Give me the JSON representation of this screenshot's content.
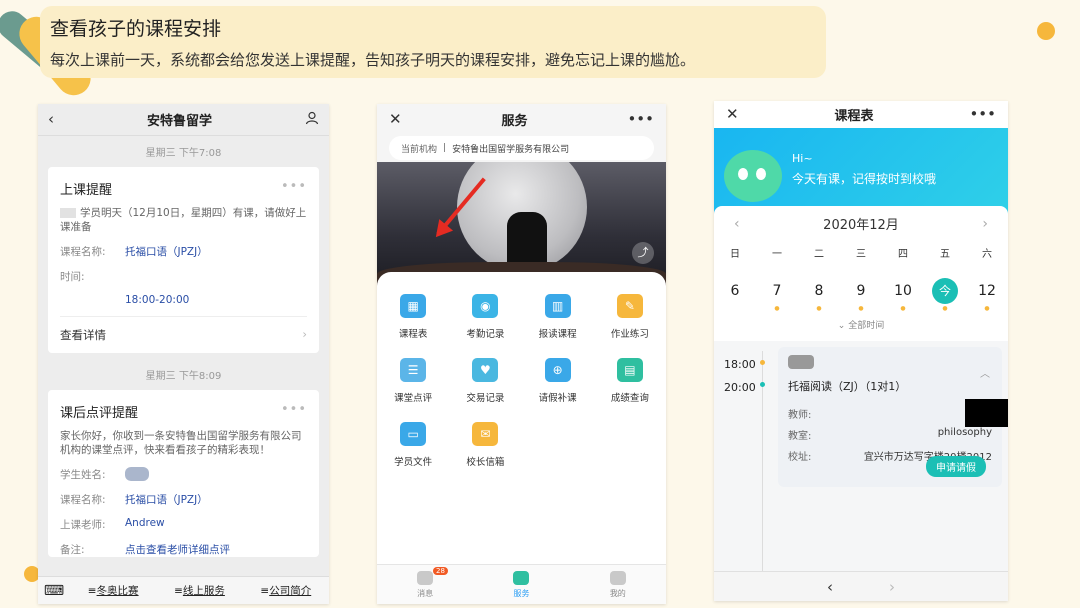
{
  "title": "查看孩子的课程安排",
  "subtitle": "每次上课前一天，系统都会给您发送上课提醒，告知孩子明天的课程安排，避免忘记上课的尴尬。",
  "phone1": {
    "back": "‹",
    "header": "安特鲁留学",
    "user_icon": "user-icon",
    "time1": "星期三 下午7:08",
    "card1": {
      "title": "上课提醒",
      "more": "•••",
      "desc": "学员明天（12月10日，星期四）有课，请做好上课准备",
      "course_label": "课程名称:",
      "course_value": "托福口语（JPZJ）",
      "time_label": "时间:",
      "time_value": "18:00-20:00",
      "detail": "查看详情",
      "detail_arrow": "›"
    },
    "time2": "星期三 下午8:09",
    "card2": {
      "title": "课后点评提醒",
      "more": "•••",
      "desc": "家长你好，你收到一条安特鲁出国留学服务有限公司机构的课堂点评，快来看看孩子的精彩表现！",
      "student_label": "学生姓名:",
      "course_label": "课程名称:",
      "course_value": "托福口语（JPZJ）",
      "teacher_label": "上课老师:",
      "teacher_value": "Andrew",
      "note_label": "备注:",
      "note_value": "点击查看老师详细点评"
    },
    "bottom_menu": [
      "冬奥比赛",
      "线上服务",
      "公司简介"
    ],
    "keyboard_icon": "⌨"
  },
  "phone2": {
    "close": "✕",
    "header": "服务",
    "more": "•••",
    "org_label": "当前机构",
    "org_sep": "|",
    "org_value": "安特鲁出国留学服务有限公司",
    "share_icon": "⤴",
    "services": [
      {
        "label": "课程表",
        "color": "#3aa8e8",
        "glyph": "▦"
      },
      {
        "label": "考勤记录",
        "color": "#3bb4e6",
        "glyph": "◉"
      },
      {
        "label": "报读课程",
        "color": "#3aa8e8",
        "glyph": "▥"
      },
      {
        "label": "作业练习",
        "color": "#f6b73c",
        "glyph": "✎"
      },
      {
        "label": "课堂点评",
        "color": "#5bb5e8",
        "glyph": "☰"
      },
      {
        "label": "交易记录",
        "color": "#4ab8e0",
        "glyph": "♥"
      },
      {
        "label": "请假补课",
        "color": "#3aa8e8",
        "glyph": "⊕"
      },
      {
        "label": "成绩查询",
        "color": "#2fbfa0",
        "glyph": "▤"
      },
      {
        "label": "学员文件",
        "color": "#3aa8e8",
        "glyph": "▭"
      },
      {
        "label": "校长信箱",
        "color": "#f6b73c",
        "glyph": "✉"
      }
    ],
    "tabs": [
      {
        "label": "消息",
        "badge": "28"
      },
      {
        "label": "服务"
      },
      {
        "label": "我的"
      }
    ]
  },
  "phone3": {
    "close": "✕",
    "header": "课程表",
    "more": "•••",
    "banner_hi": "Hi~",
    "banner_msg": "今天有课，记得按时到校哦",
    "month": "2020年12月",
    "prev": "‹",
    "next": "›",
    "weekdays": [
      "日",
      "一",
      "二",
      "三",
      "四",
      "五",
      "六"
    ],
    "days": [
      "6",
      "7",
      "8",
      "9",
      "10",
      "今",
      "12"
    ],
    "day_dot": "●",
    "all_time": "⌄ 全部时间",
    "times": [
      "18:00",
      "20:00"
    ],
    "course": "托福阅读（ZJ）（1对1）",
    "teacher_label": "教师:",
    "room_label": "教室:",
    "room_value": "philosophy",
    "campus_label": "校址:",
    "campus_value": "宜兴市万达写字楼20楼2012",
    "leave_button": "申请请假",
    "collapse": "︿",
    "bottom_back": "‹",
    "bottom_next": "›"
  },
  "colors": {
    "accent_teal": "#1bbfb5",
    "accent_yellow": "#f6b73c",
    "arrow_red": "#e52b22",
    "banner_blue": "#19b6f1"
  }
}
